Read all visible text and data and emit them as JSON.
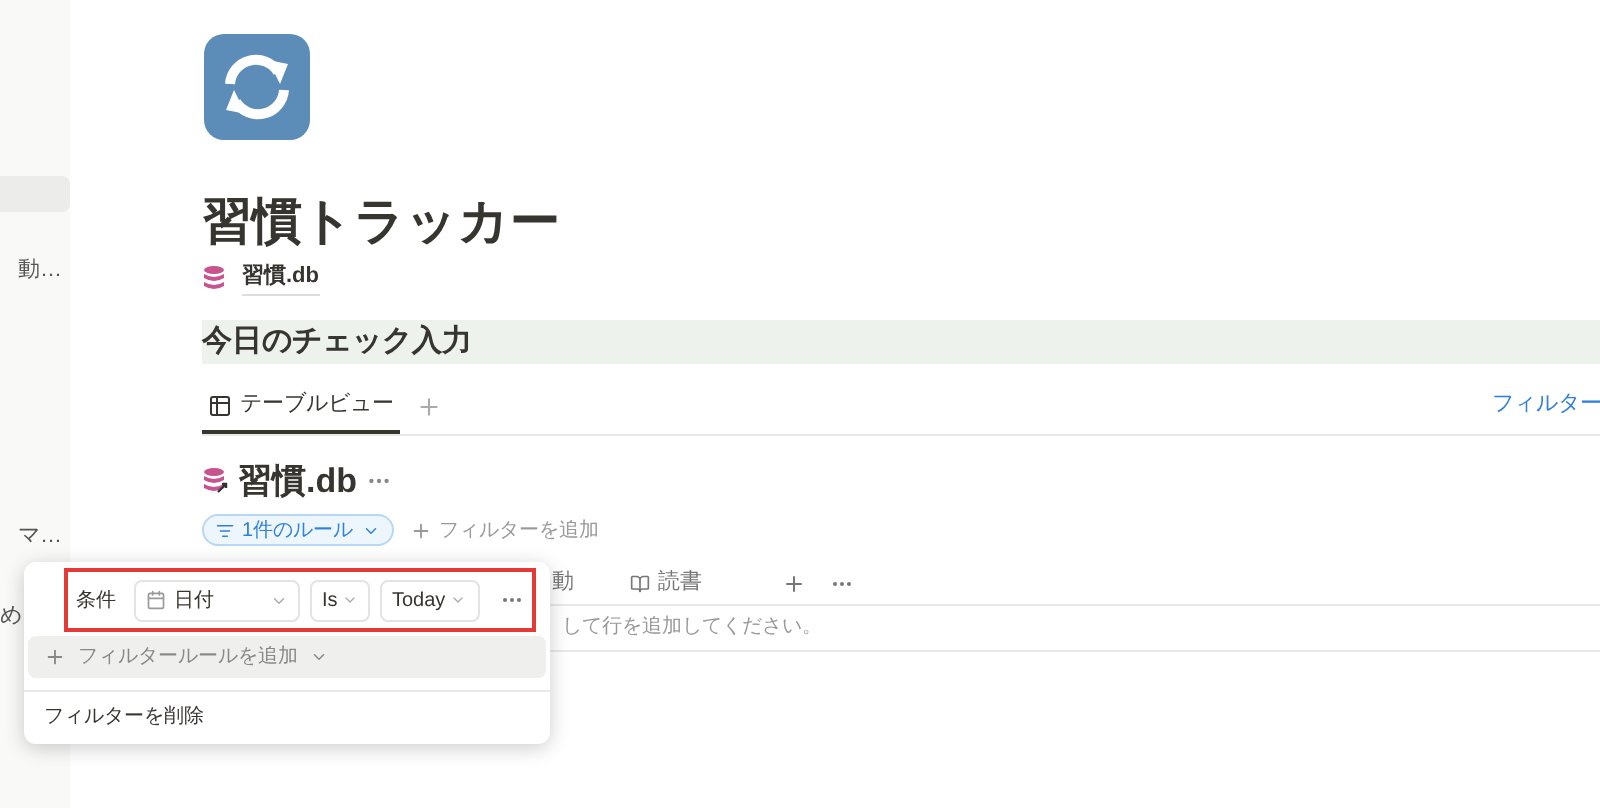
{
  "sidebar": {
    "items": [
      {
        "selected": true
      },
      {
        "label": "動…",
        "selected": false
      },
      {
        "label": "マ…",
        "selected": false
      },
      {
        "label": "め",
        "selected": false
      }
    ]
  },
  "page": {
    "title": "習慣トラッカー",
    "db_link": "習慣.db",
    "heading": "今日のチェック入力"
  },
  "view_tabs": [
    {
      "label": "テーブルビュー",
      "selected": true
    }
  ],
  "filter_link": "フィルター",
  "database": {
    "title": "習慣.db",
    "filter_pill": "1件のルール",
    "add_filter": "フィルターを追加",
    "columns": [
      "動",
      "読書"
    ],
    "empty_row": "して行を追加してください。"
  },
  "filter_popup": {
    "rule": {
      "label": "条件",
      "property": "日付",
      "operator": "Is",
      "value": "Today"
    },
    "add_rule": "フィルタールールを追加",
    "delete": "フィルターを削除"
  }
}
